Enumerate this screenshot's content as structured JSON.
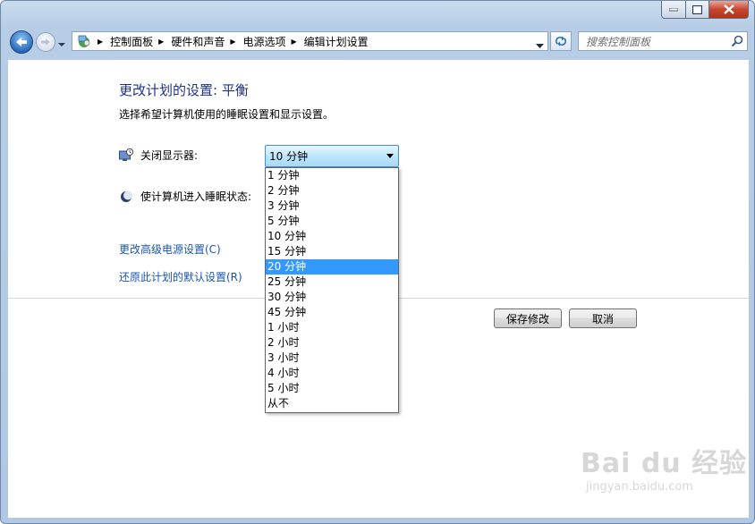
{
  "titlebar": {
    "icons": [
      "minimize-icon",
      "maximize-icon",
      "close-icon"
    ]
  },
  "address": {
    "crumbs": [
      "控制面板",
      "硬件和声音",
      "电源选项",
      "编辑计划设置"
    ]
  },
  "search": {
    "placeholder": "搜索控制面板"
  },
  "main": {
    "heading": "更改计划的设置: 平衡",
    "subtext": "选择希望计算机使用的睡眠设置和显示设置。",
    "display_label": "关闭显示器:",
    "display_value": "10 分钟",
    "sleep_label": "使计算机进入睡眠状态:",
    "advanced_link": "更改高级电源设置(C)",
    "restore_link": "还原此计划的默认设置(R)",
    "save_button": "保存修改",
    "cancel_button": "取消"
  },
  "dropdown": {
    "options": [
      "1 分钟",
      "2 分钟",
      "3 分钟",
      "5 分钟",
      "10 分钟",
      "15 分钟",
      "20 分钟",
      "25 分钟",
      "30 分钟",
      "45 分钟",
      "1 小时",
      "2 小时",
      "3 小时",
      "4 小时",
      "5 小时",
      "从不"
    ],
    "highlighted": "20 分钟"
  },
  "watermark": {
    "main": "Bai du 经验",
    "sub": "jingyan.baidu.com"
  },
  "colors": {
    "heading": "#1e3287",
    "link": "#1a55b5",
    "highlight": "#3399ff"
  }
}
